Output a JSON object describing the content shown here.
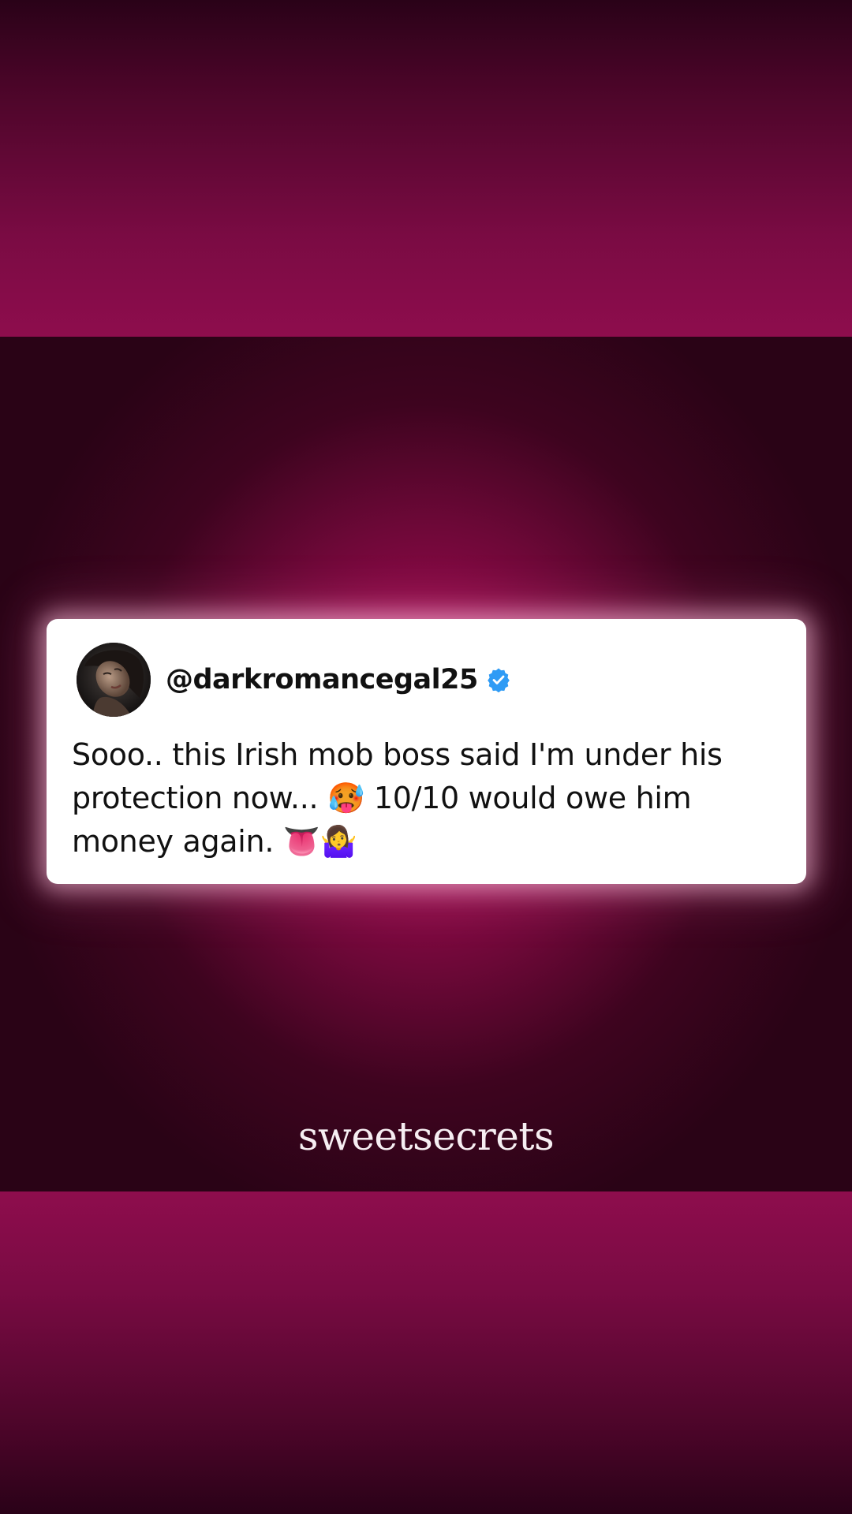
{
  "post": {
    "handle": "@darkromancegal25",
    "text": "Sooo.. this Irish mob boss said I'm under his protection now... 🥵 10/10 would owe him money again. 👅🤷‍♀️",
    "verified_icon": "verified-badge-icon",
    "avatar_icon": "profile-photo"
  },
  "brand": {
    "name": "sweetsecrets"
  },
  "colors": {
    "background_dark": "#2a0316",
    "background_glow": "#b80a5c",
    "card": "#ffffff",
    "verified": "#2f9bf5",
    "brand_text": "#f6eef2"
  }
}
